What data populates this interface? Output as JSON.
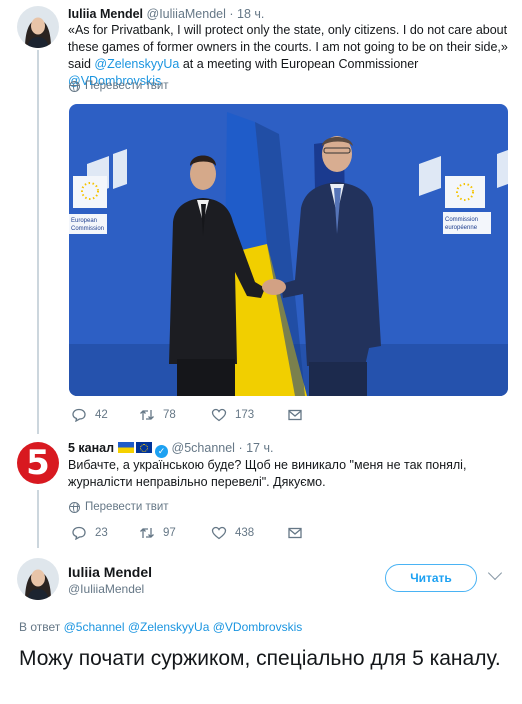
{
  "tweet1": {
    "name": "Iuliia Mendel",
    "handle": "@IuliiaMendel",
    "time": "18 ч.",
    "text_before": "«As for Privatbank, I will protect only the state, only citizens. I do not care about these games of former owners in the courts. I am not going to be on their side,» said ",
    "mention1": "@ZelenskyyUa",
    "text_middle": " at a meeting with European Commissioner ",
    "mention2": "@VDombrovskis",
    "translate": "Перевести твит",
    "image_sign_left": "European Commission",
    "image_sign_right": "Commission européenne",
    "replies": "42",
    "retweets": "78",
    "likes": "173"
  },
  "tweet2": {
    "name": "5 канал",
    "logo_char": "5",
    "handle": "@5channel",
    "time": "17 ч.",
    "text": "Вибачте, а українською буде? Щоб не виникало \"меня не так понялі, журналісти неправільно перевелі\". Дякуємо.",
    "translate": "Перевести твит",
    "replies": "23",
    "retweets": "97",
    "likes": "438"
  },
  "main": {
    "name": "Iuliia Mendel",
    "handle": "@IuliiaMendel",
    "follow_label": "Читать",
    "reply_prefix": "В ответ",
    "reply_to_1": "@5channel",
    "reply_to_2": "@ZelenskyyUa",
    "reply_to_3": "@VDombrovskis",
    "text": "Можу почати суржиком, спеціально для 5 каналу."
  },
  "colors": {
    "link": "#1b95e0",
    "follow": "#1da1f2",
    "muted": "#657786",
    "thread": "#ccd6dd",
    "channel5": "#d81920"
  },
  "icons": [
    "globe-icon",
    "reply-icon",
    "retweet-icon",
    "like-icon",
    "message-icon",
    "verified-icon",
    "chevron-down-icon"
  ]
}
